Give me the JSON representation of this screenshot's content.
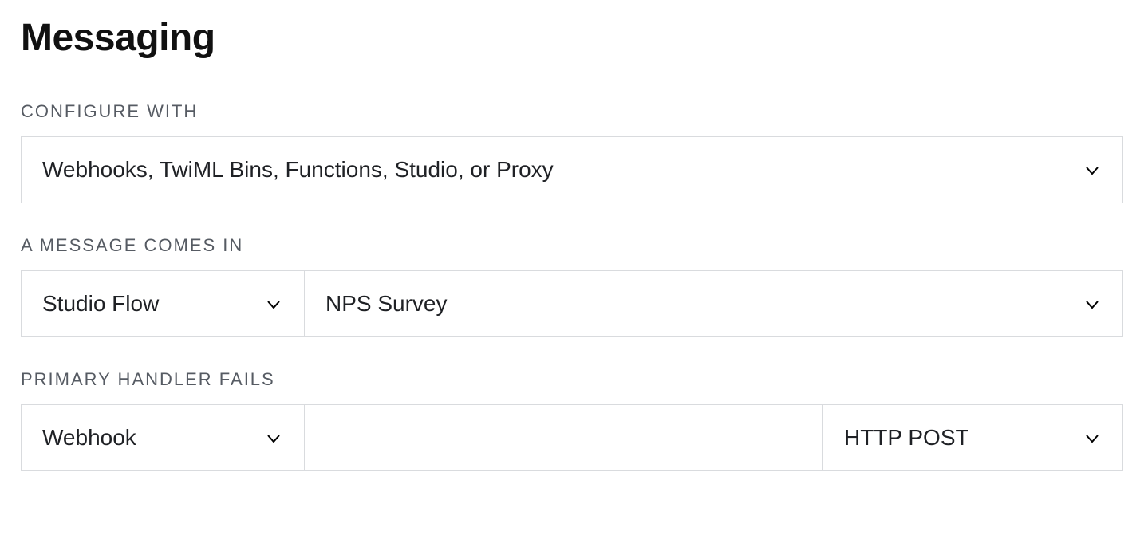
{
  "title": "Messaging",
  "configure_with": {
    "label": "CONFIGURE WITH",
    "value": "Webhooks, TwiML Bins, Functions, Studio, or Proxy"
  },
  "message_comes_in": {
    "label": "A MESSAGE COMES IN",
    "type_value": "Studio Flow",
    "target_value": "NPS Survey"
  },
  "primary_handler_fails": {
    "label": "PRIMARY HANDLER FAILS",
    "type_value": "Webhook",
    "url_value": "",
    "method_value": "HTTP POST"
  }
}
